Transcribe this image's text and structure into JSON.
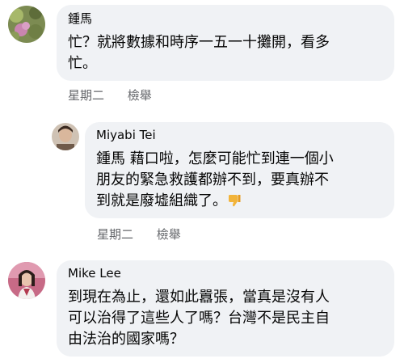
{
  "comments": [
    {
      "author": "鍾馬",
      "text_lines": [
        "忙？就將數據和時序一五一十攤開，看多",
        "忙。"
      ],
      "time": "星期二",
      "report": "檢舉"
    },
    {
      "author": "Miyabi Tei",
      "text_lines": [
        "鍾馬 藉口啦，怎麼可能忙到連一個小",
        "朋友的緊急救護都辦不到，要真辦不",
        "到就是廢墟組織了。"
      ],
      "emoji": "thumbs-down-icon",
      "time": "星期二",
      "report": "檢舉"
    },
    {
      "author": "Mike Lee",
      "text_lines": [
        "到現在為止，還如此囂張，當真是沒有人",
        "可以治得了這些人了嗎？台灣不是民主自",
        "由法治的國家嗎？"
      ]
    }
  ]
}
